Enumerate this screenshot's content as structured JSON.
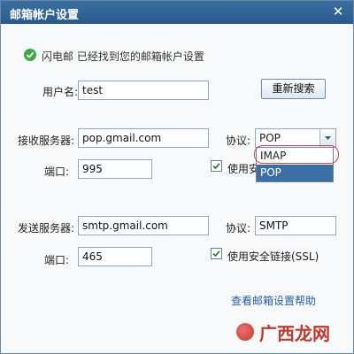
{
  "window": {
    "title": "邮箱帐户设置"
  },
  "status": {
    "message": "闪电邮 已经找到您的邮箱帐户设置"
  },
  "username": {
    "label": "用户名:",
    "value": "test"
  },
  "research_button": {
    "label": "重新搜索"
  },
  "incoming": {
    "server_label": "接收服务器:",
    "server_value": "pop.gmail.com",
    "port_label": "端口:",
    "port_value": "995",
    "protocol_label": "协议:",
    "protocol_value": "POP",
    "ssl_label": "使用安全链接(SSL)",
    "ssl_checked": true,
    "protocol_options": [
      {
        "label": "IMAP",
        "selected": false
      },
      {
        "label": "POP",
        "selected": true
      }
    ]
  },
  "outgoing": {
    "server_label": "发送服务器:",
    "server_value": "smtp.gmail.com",
    "port_label": "端口:",
    "port_value": "465",
    "protocol_label": "协议:",
    "protocol_value": "SMTP",
    "ssl_label": "使用安全链接(SSL)",
    "ssl_checked": true
  },
  "help_link": {
    "label": "查看邮箱设置帮助"
  },
  "watermark": {
    "text": "广西龙网"
  },
  "colors": {
    "title_bar": "#285a8d",
    "accent": "#3a6ea5",
    "check_green": "#3ba94a",
    "highlight_red": "#d8434a"
  }
}
